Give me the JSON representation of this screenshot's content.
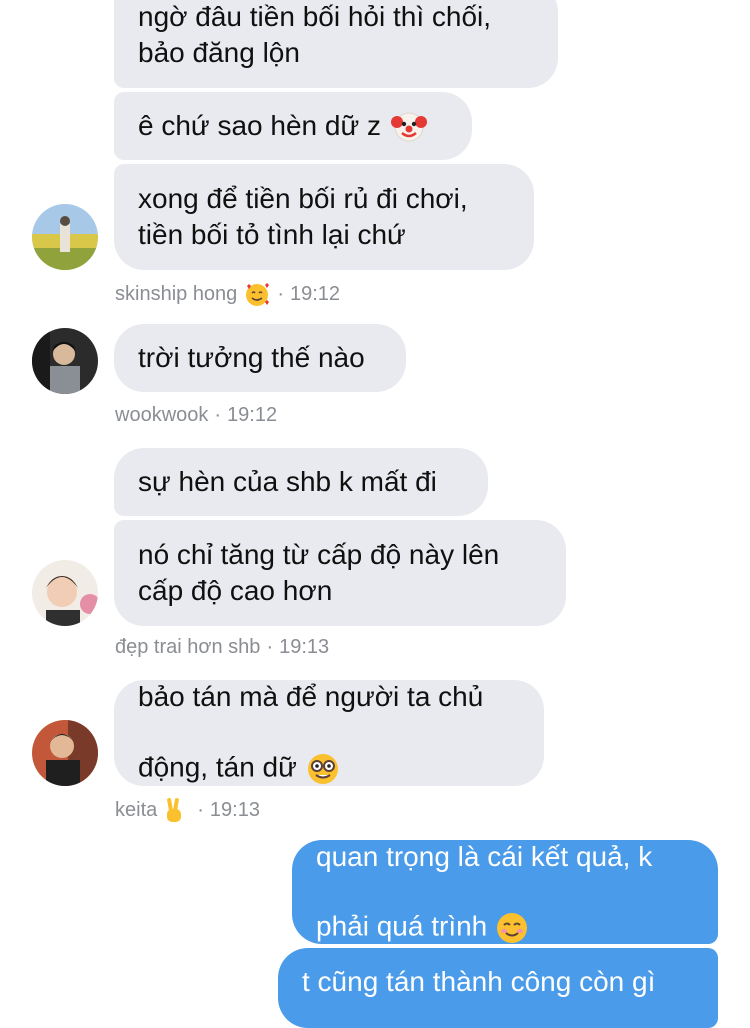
{
  "messages": [
    {
      "text": "ngờ đâu tiền bối hỏi thì chối,\nbảo đăng lộn"
    },
    {
      "text": "ê chứ sao hèn dữ z",
      "emoji": "clown-face-emoji"
    },
    {
      "text": "xong để tiền bối rủ đi chơi,\ntiền bối tỏ tình lại chứ"
    },
    {
      "text": "trời tưởng thế nào"
    },
    {
      "text": "sự hèn của shb k mất đi"
    },
    {
      "text": "nó chỉ tăng từ cấp độ này lên\ncấp độ cao hơn"
    },
    {
      "text": "bảo tán mà để người ta chủ\nđộng, tán dữ",
      "emoji": "nerd-face-emoji"
    },
    {
      "text": "quan trọng là cái kết quả, k\nphải quá trình",
      "emoji": "smiling-face-emoji"
    },
    {
      "text": "t cũng tán thành công còn gì"
    }
  ],
  "senders": [
    {
      "name": "skinship hong",
      "emoji": "smiling-face-with-hearts-emoji",
      "time": "19:12"
    },
    {
      "name": "wookwook",
      "time": "19:12"
    },
    {
      "name": "đẹp trai hơn shb",
      "time": "19:13"
    },
    {
      "name": "keita",
      "emoji": "victory-hand-emoji",
      "time": "19:13"
    }
  ],
  "separator": "·",
  "colors": {
    "incoming_bubble": "#e9eaef",
    "outgoing_bubble": "#4a9be9",
    "meta_text": "#8a8d93"
  }
}
